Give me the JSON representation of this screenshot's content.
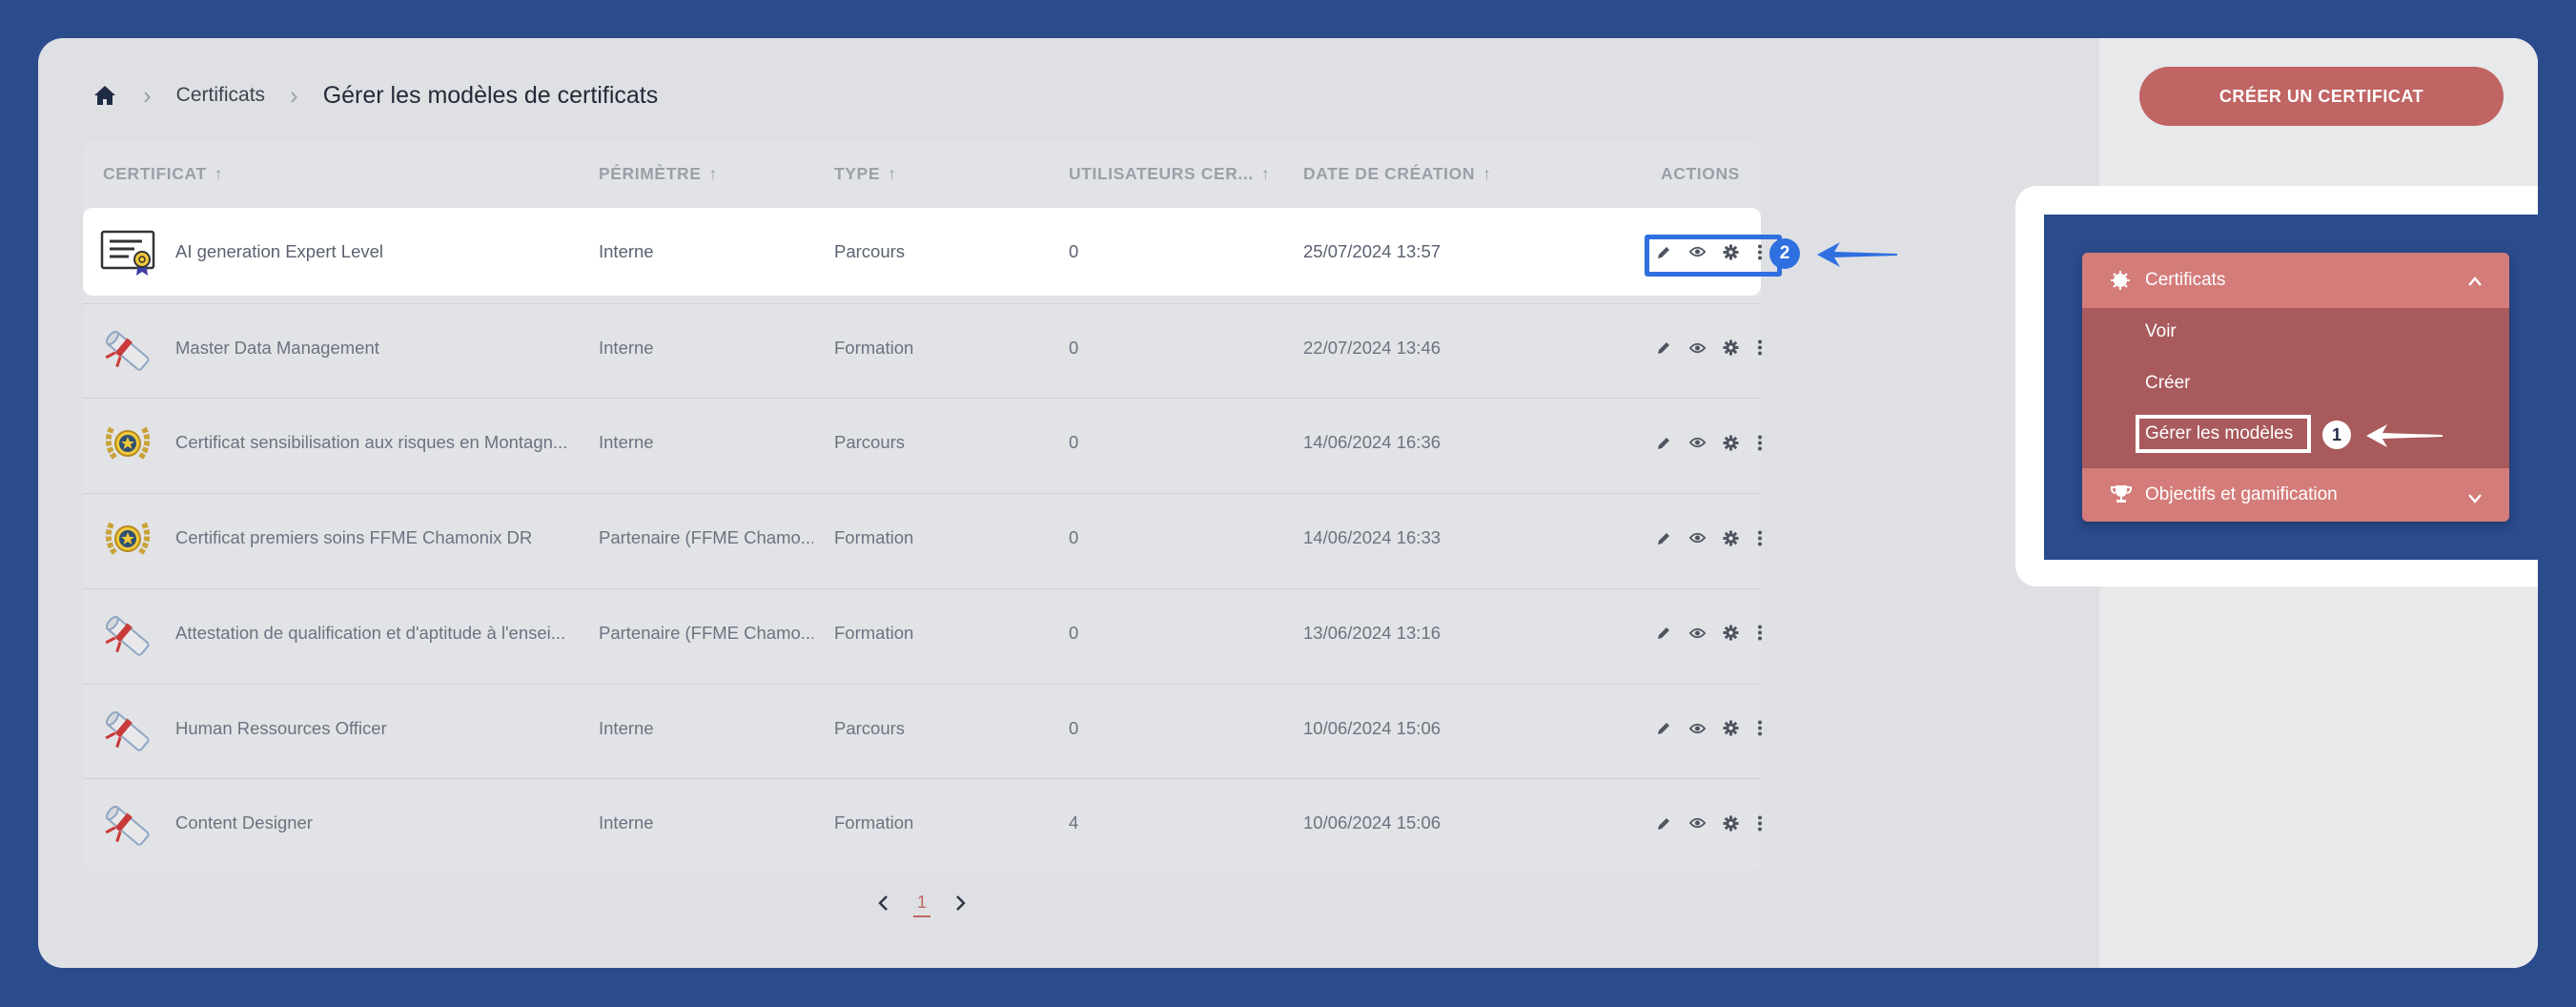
{
  "breadcrumb": {
    "items": [
      "Certificats"
    ],
    "current": "Gérer les modèles de certificats"
  },
  "create_button": "CRÉER UN CERTIFICAT",
  "table": {
    "columns": [
      {
        "label": "CERTIFICAT",
        "sort": "↑"
      },
      {
        "label": "PÉRIMÈTRE",
        "sort": "↑"
      },
      {
        "label": "TYPE",
        "sort": "↑"
      },
      {
        "label": "UTILISATEURS CER...",
        "sort": "↑"
      },
      {
        "label": "DATE DE CRÉATION",
        "sort": "↑"
      },
      {
        "label": "ACTIONS",
        "sort": ""
      }
    ],
    "rows": [
      {
        "name": "AI generation Expert Level",
        "perimetre": "Interne",
        "type": "Parcours",
        "users": "0",
        "date": "25/07/2024 13:57",
        "icon": "certificate-document-icon"
      },
      {
        "name": "Master Data Management",
        "perimetre": "Interne",
        "type": "Formation",
        "users": "0",
        "date": "22/07/2024 13:46",
        "icon": "diploma-scroll-icon"
      },
      {
        "name": "Certificat sensibilisation aux risques en Montagn...",
        "perimetre": "Interne",
        "type": "Parcours",
        "users": "0",
        "date": "14/06/2024 16:36",
        "icon": "laurel-medal-icon"
      },
      {
        "name": "Certificat premiers soins FFME Chamonix DR",
        "perimetre": "Partenaire (FFME Chamo...",
        "type": "Formation",
        "users": "0",
        "date": "14/06/2024 16:33",
        "icon": "laurel-medal-icon"
      },
      {
        "name": "Attestation de qualification et d'aptitude à l'ensei...",
        "perimetre": "Partenaire (FFME Chamo...",
        "type": "Formation",
        "users": "0",
        "date": "13/06/2024 13:16",
        "icon": "diploma-scroll-icon"
      },
      {
        "name": "Human Ressources Officer",
        "perimetre": "Interne",
        "type": "Parcours",
        "users": "0",
        "date": "10/06/2024 15:06",
        "icon": "diploma-scroll-icon"
      },
      {
        "name": "Content Designer",
        "perimetre": "Interne",
        "type": "Formation",
        "users": "4",
        "date": "10/06/2024 15:06",
        "icon": "diploma-scroll-icon"
      }
    ]
  },
  "pagination": {
    "current": "1"
  },
  "callouts": {
    "step1": "1",
    "step2": "2"
  },
  "menu": {
    "section": "Certificats",
    "items": [
      "Voir",
      "Créer",
      "Gérer les modèles"
    ],
    "next_section": "Objectifs et gamification"
  },
  "colors": {
    "accent": "#c06563",
    "highlight_blue": "#2f6fe0",
    "background": "#2a4b8c"
  }
}
